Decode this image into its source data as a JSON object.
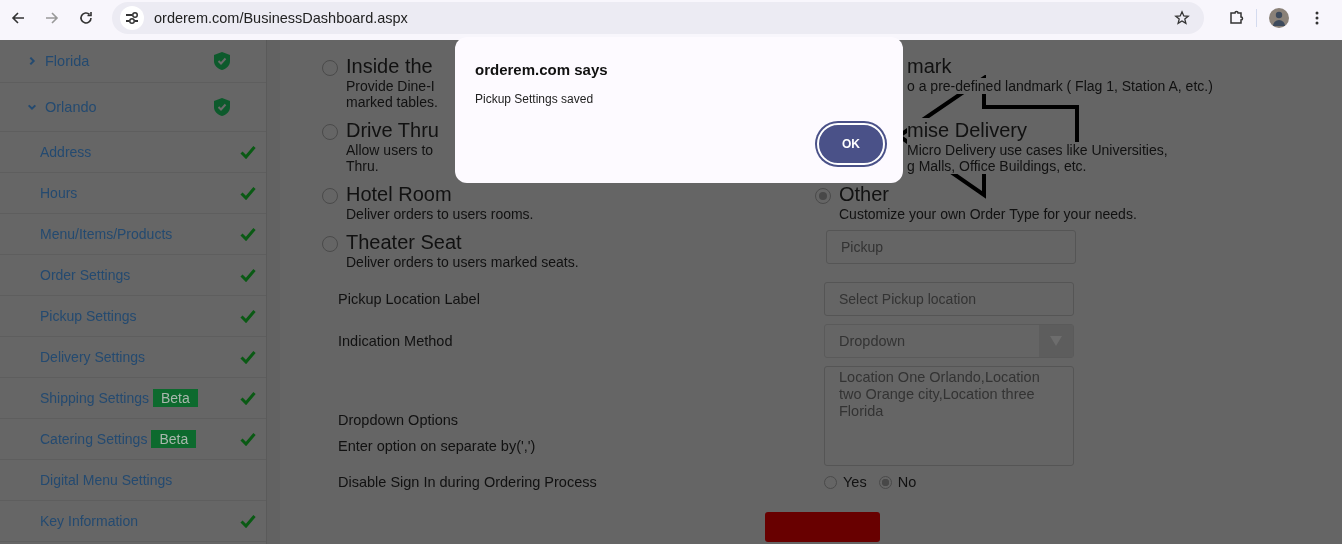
{
  "browser": {
    "url": "orderem.com/BusinessDashboard.aspx"
  },
  "sidebar": {
    "locations": [
      {
        "name": "Florida",
        "expanded": false,
        "verified": true
      },
      {
        "name": "Orlando",
        "expanded": true,
        "verified": true,
        "children": [
          {
            "label": "Address",
            "checked": true
          },
          {
            "label": "Hours",
            "checked": true
          },
          {
            "label": "Menu/Items/Products",
            "checked": true
          },
          {
            "label": "Order Settings",
            "checked": true
          },
          {
            "label": "Pickup Settings",
            "checked": true
          },
          {
            "label": "Delivery Settings",
            "checked": true
          },
          {
            "label": "Shipping Settings",
            "badge": "Beta",
            "checked": true
          },
          {
            "label": "Catering Settings",
            "badge": "Beta",
            "checked": true
          },
          {
            "label": "Digital Menu Settings",
            "checked": false
          },
          {
            "label": "Key Information",
            "checked": true
          }
        ]
      }
    ]
  },
  "order_types": {
    "left": [
      {
        "title": "Inside the",
        "lines": [
          "Provide Dine-I",
          "marked tables."
        ],
        "selected": false
      },
      {
        "title": "Drive Thru",
        "lines": [
          "Allow users to",
          "Thru."
        ],
        "selected": false
      },
      {
        "title": "Hotel Room",
        "lines": [
          "Deliver orders to users rooms."
        ],
        "selected": false
      },
      {
        "title": "Theater Seat",
        "lines": [
          "Deliver orders to users marked seats."
        ],
        "selected": false
      }
    ],
    "right": [
      {
        "title": "mark",
        "lines": [
          "o a pre-defined landmark ( Flag 1, Station A, etc.)"
        ],
        "cut": true
      },
      {
        "title": "mise Delivery",
        "lines": [
          "Micro Delivery use cases like Universities,",
          "g Malls, Office Buildings, etc."
        ],
        "cut": true
      },
      {
        "title": "Other",
        "lines": [
          "Customize your own Order Type for your needs."
        ],
        "selected": true,
        "cut": false
      }
    ],
    "other_field": {
      "placeholder": "Pickup"
    }
  },
  "form": {
    "pickup_location_label": {
      "label": "Pickup Location Label",
      "placeholder": "Select Pickup location"
    },
    "indication_method": {
      "label": "Indication Method",
      "value": "Dropdown"
    },
    "dropdown_options": {
      "label": "Dropdown Options",
      "hint": "Enter option on separate by(',')",
      "value": "Location One Orlando,Location two Orange city,Location three Florida"
    },
    "disable_sign_in": {
      "label": "Disable Sign In during Ordering Process",
      "options": [
        {
          "label": "Yes",
          "selected": false
        },
        {
          "label": "No",
          "selected": true
        }
      ]
    }
  },
  "dialog": {
    "title": "orderem.com says",
    "message": "Pickup Settings saved",
    "button": "OK"
  }
}
